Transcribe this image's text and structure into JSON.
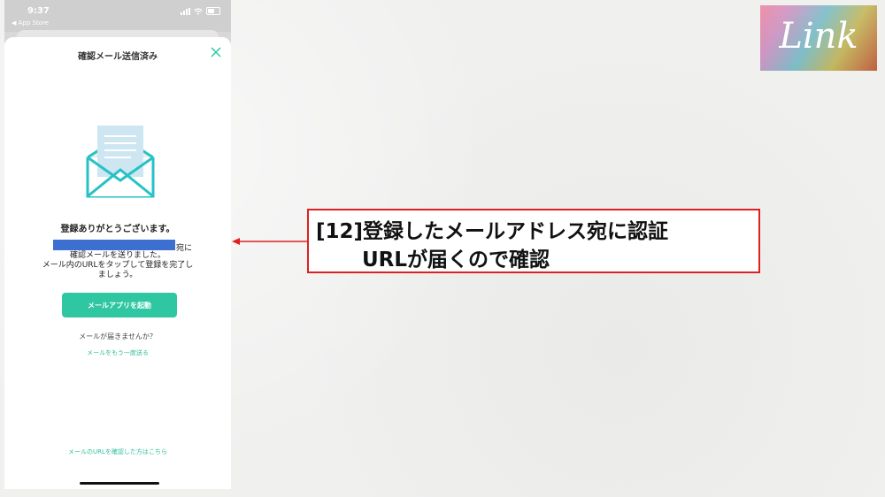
{
  "status_bar": {
    "time": "9:37",
    "back_label": "◀ App Store"
  },
  "sheet": {
    "title": "確認メール送信済み",
    "thanks": "登録ありがとうございます。",
    "after_email": "宛に",
    "body_lines": [
      "確認メールを送りました。",
      "メール内のURLをタップして登録を完了し",
      "ましょう。"
    ],
    "launch_button": "メールアプリを起動",
    "not_received": "メールが届きませんか？",
    "resend_link": "メールをもう一度送る",
    "confirm_link": "メールのURLを確認した方はこちら"
  },
  "logo": {
    "text": "Link"
  },
  "callout": {
    "line1": "[12]登録したメールアドレス宛に認証",
    "line2": "URLが届くので確認"
  },
  "colors": {
    "accent": "#2fc7a2",
    "callout_border": "#e02020",
    "redaction": "#3d6fd1"
  }
}
